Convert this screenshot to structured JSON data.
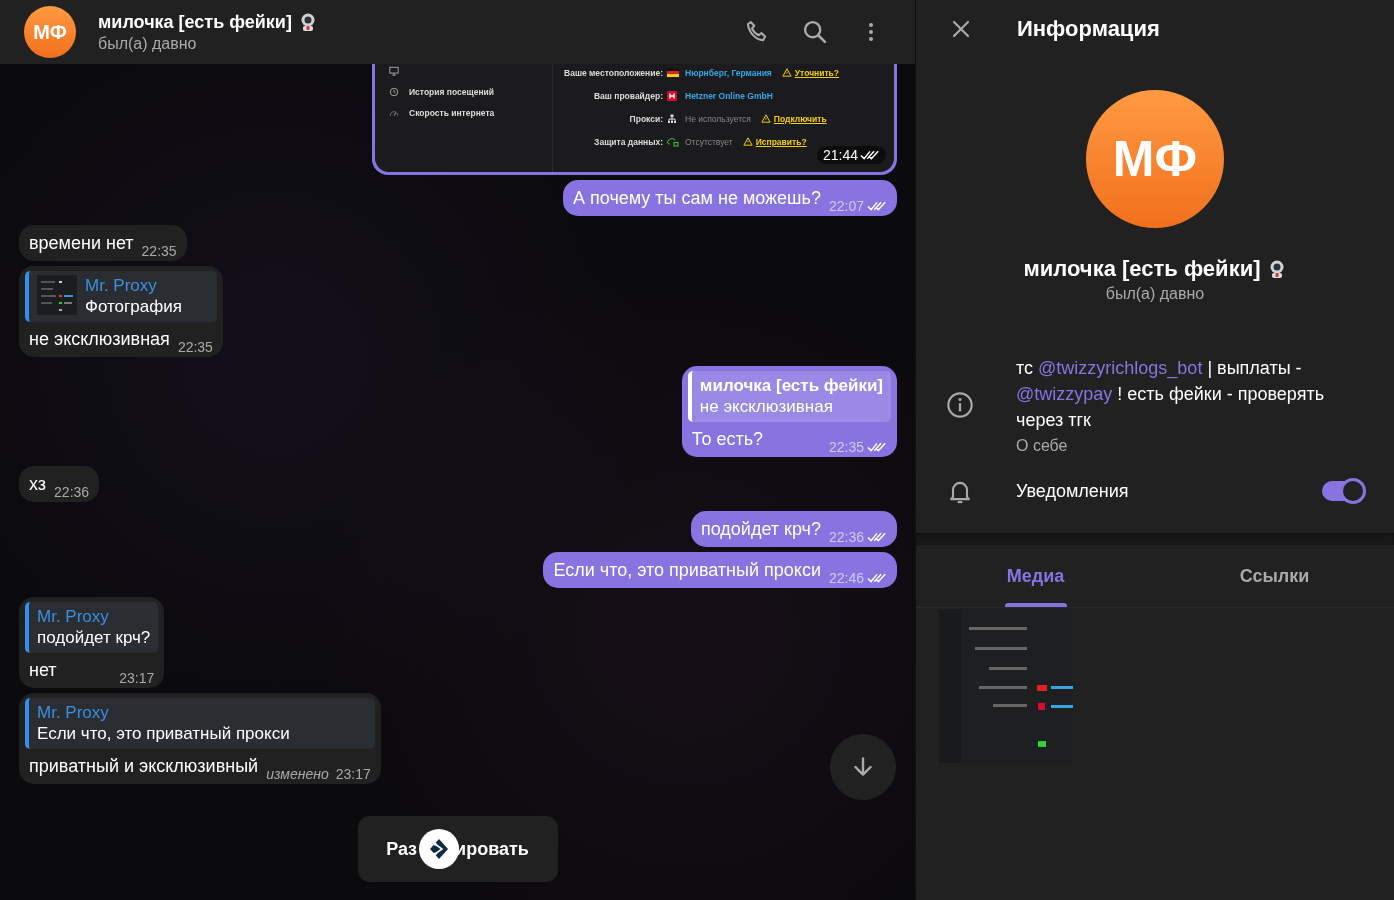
{
  "header": {
    "avatar_initials": "МФ",
    "name": "милочка [есть фейки]",
    "status": "был(а) давно"
  },
  "messages": [
    {
      "outgoing": true,
      "time": "21:44",
      "read": true,
      "photo": {
        "menu": [
          "История посещений",
          "Скорость интернета"
        ],
        "rows": [
          {
            "label": "Ваше местоположение:",
            "value": "Нюрнберг, Германия",
            "highlighted": true,
            "action": "Уточнить?"
          },
          {
            "label": "Ваш провайдер:",
            "value": "Hetzner Online GmbH",
            "highlighted": true
          },
          {
            "label": "Прокси:",
            "value": "Не используется",
            "highlighted": false,
            "action": "Подключить"
          },
          {
            "label": "Защита данных:",
            "value": "Отсутствует",
            "highlighted": false,
            "action": "Исправить?"
          }
        ]
      }
    },
    {
      "outgoing": true,
      "kind": "text",
      "text": "А почему ты сам не можешь?",
      "time": "22:07",
      "read": true
    },
    {
      "outgoing": false,
      "kind": "text",
      "text": "времени нет",
      "time": "22:35"
    },
    {
      "outgoing": false,
      "kind": "text",
      "reply": {
        "author": "Mr. Proxy",
        "text": "Фотография"
      },
      "text": "не эксклюзивная",
      "time": "22:35"
    },
    {
      "outgoing": true,
      "kind": "text",
      "reply": {
        "author": "милочка [есть фейки]",
        "text": "не эксклюзивная"
      },
      "text": "То есть?",
      "time": "22:35",
      "read": true
    },
    {
      "outgoing": false,
      "kind": "text",
      "text": "хз",
      "time": "22:36"
    },
    {
      "outgoing": true,
      "kind": "text",
      "text": "подойдет крч?",
      "time": "22:36",
      "read": true
    },
    {
      "outgoing": true,
      "kind": "text",
      "text": "Если что, это приватный прокси",
      "time": "22:46",
      "read": true
    },
    {
      "outgoing": false,
      "kind": "text",
      "reply": {
        "author": "Mr. Proxy",
        "text": "подойдет крч?"
      },
      "text": "нет",
      "time": "23:17"
    },
    {
      "outgoing": false,
      "kind": "text",
      "reply": {
        "author": "Mr. Proxy",
        "text": "Если что, это приватный прокси"
      },
      "text": "приватный и эксклюзивный",
      "edited": "изменено",
      "time": "23:17"
    }
  ],
  "unblock_button": {
    "visible_parts": [
      "Раз",
      "ировать"
    ]
  },
  "info": {
    "title": "Информация",
    "avatar_initials": "МФ",
    "name": "милочка [есть фейки]",
    "status": "был(а) давно",
    "bio": [
      {
        "text": "тс "
      },
      {
        "text": "@twizzyrichlogs_bot",
        "link": true
      },
      {
        "text": " | выплаты - "
      },
      {
        "text": "@twizzypay",
        "link": true
      },
      {
        "text": " ! есть фейки - проверять через тгк"
      }
    ],
    "bio_caption": "О себе",
    "notifications": {
      "label": "Уведомления",
      "on": true
    },
    "tabs": [
      {
        "label": "Медиа",
        "selected": true
      },
      {
        "label": "Ссылки",
        "selected": false
      }
    ]
  }
}
